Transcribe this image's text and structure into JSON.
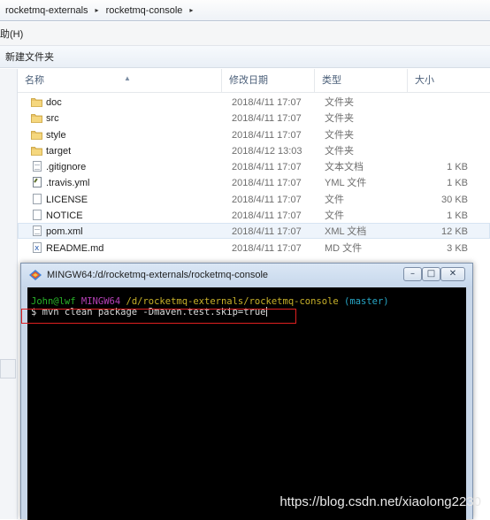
{
  "breadcrumb": {
    "items": [
      "rocketmq-externals",
      "rocketmq-console"
    ],
    "separator": "▸"
  },
  "menu": {
    "help_label": "助(H)"
  },
  "toolbar": {
    "new_folder_label": "新建文件夹"
  },
  "columns": {
    "name": "名称",
    "modified": "修改日期",
    "type": "类型",
    "size": "大小"
  },
  "files": [
    {
      "name": "doc",
      "modified": "2018/4/11 17:07",
      "type": "文件夹",
      "size": "",
      "icon": "folder-icon"
    },
    {
      "name": "src",
      "modified": "2018/4/11 17:07",
      "type": "文件夹",
      "size": "",
      "icon": "folder-icon"
    },
    {
      "name": "style",
      "modified": "2018/4/11 17:07",
      "type": "文件夹",
      "size": "",
      "icon": "folder-icon"
    },
    {
      "name": "target",
      "modified": "2018/4/12 13:03",
      "type": "文件夹",
      "size": "",
      "icon": "folder-icon"
    },
    {
      "name": ".gitignore",
      "modified": "2018/4/11 17:07",
      "type": "文本文档",
      "size": "1 KB",
      "icon": "text-file-icon"
    },
    {
      "name": ".travis.yml",
      "modified": "2018/4/11 17:07",
      "type": "YML 文件",
      "size": "1 KB",
      "icon": "yml-file-icon"
    },
    {
      "name": "LICENSE",
      "modified": "2018/4/11 17:07",
      "type": "文件",
      "size": "30 KB",
      "icon": "file-icon"
    },
    {
      "name": "NOTICE",
      "modified": "2018/4/11 17:07",
      "type": "文件",
      "size": "1 KB",
      "icon": "file-icon"
    },
    {
      "name": "pom.xml",
      "modified": "2018/4/11 17:07",
      "type": "XML 文档",
      "size": "12 KB",
      "icon": "xml-file-icon",
      "selected": true
    },
    {
      "name": "README.md",
      "modified": "2018/4/11 17:07",
      "type": "MD 文件",
      "size": "3 KB",
      "icon": "md-file-icon"
    }
  ],
  "terminal": {
    "title": "MINGW64:/d/rocketmq-externals/rocketmq-console",
    "prompt_user": "John@lwf",
    "prompt_env": "MINGW64",
    "prompt_path": "/d/rocketmq-externals/rocketmq-console",
    "prompt_branch": "(master)",
    "command": "$ mvn clean package -Dmaven.test.skip=true",
    "buttons": {
      "minimize": "–",
      "maximize": "□",
      "close": "✕"
    }
  },
  "watermark": "https://blog.csdn.net/xiaolong2230",
  "colors": {
    "terminal_bg": "#000000",
    "prompt_green": "#28b228",
    "prompt_magenta": "#b540b5",
    "prompt_yellow": "#c9b22a",
    "prompt_cyan": "#28a8c8",
    "highlight_red": "#e02020"
  }
}
